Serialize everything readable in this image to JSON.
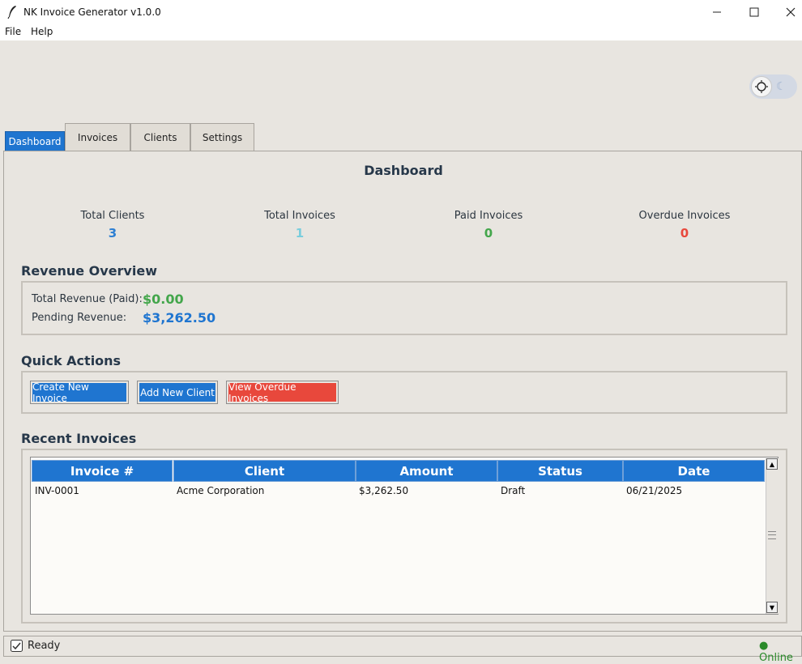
{
  "window": {
    "title": "NK Invoice Generator v1.0.0"
  },
  "menu": [
    "File",
    "Help"
  ],
  "tabs": [
    "Dashboard",
    "Invoices",
    "Clients",
    "Settings"
  ],
  "dashboard": {
    "title": "Dashboard",
    "stats": [
      {
        "label": "Total Clients",
        "value": "3",
        "color": "#2d7fd3"
      },
      {
        "label": "Total Invoices",
        "value": "1",
        "color": "#79cddd"
      },
      {
        "label": "Paid Invoices",
        "value": "0",
        "color": "#43a64b"
      },
      {
        "label": "Overdue Invoices",
        "value": "0",
        "color": "#e8483c"
      }
    ],
    "revenue": {
      "title": "Revenue Overview",
      "paid_label": "Total Revenue (Paid):",
      "paid_value": "$0.00",
      "pending_label": "Pending Revenue:",
      "pending_value": "$3,262.50"
    },
    "quick_actions": {
      "title": "Quick Actions",
      "create_invoice": "Create New Invoice",
      "add_client": "Add New Client",
      "view_overdue": "View Overdue Invoices"
    },
    "recent": {
      "title": "Recent Invoices",
      "columns": [
        "Invoice #",
        "Client",
        "Amount",
        "Status",
        "Date"
      ],
      "rows": [
        [
          "INV-0001",
          "Acme Corporation",
          "$3,262.50",
          "Draft",
          "06/21/2025"
        ]
      ]
    }
  },
  "status": {
    "text": "Ready",
    "connection": "● Online"
  },
  "colors": {
    "accent": "#1f75d0",
    "danger": "#e8483c",
    "success": "#43a64b"
  }
}
